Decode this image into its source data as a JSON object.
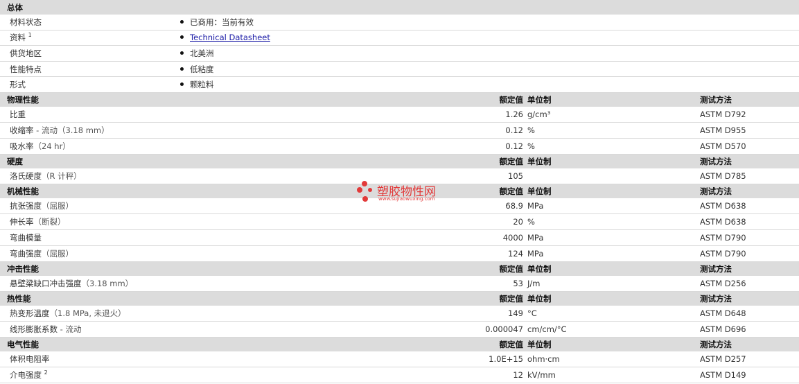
{
  "general": {
    "title": "总体",
    "rows": [
      {
        "label": "材料状态",
        "value": "已商用：当前有效"
      },
      {
        "label": "资料",
        "sup": "1",
        "value": "Technical Datasheet",
        "link": true
      },
      {
        "label": "供货地区",
        "value": "北美洲"
      },
      {
        "label": "性能特点",
        "value": "低粘度"
      },
      {
        "label": "形式",
        "value": "颗粒料"
      }
    ]
  },
  "col_headers": {
    "value": "额定值",
    "unit": "单位制",
    "test": "测试方法"
  },
  "sections": [
    {
      "title": "物理性能",
      "rows": [
        {
          "label": "比重",
          "sub": "",
          "value": "1.26",
          "unit": "g/cm³",
          "test": "ASTM D792"
        },
        {
          "label": "收缩率",
          "sub": " - 流动（3.18 mm）",
          "value": "0.12",
          "unit": "%",
          "test": "ASTM D955"
        },
        {
          "label": "吸水率",
          "sub": "（24 hr）",
          "value": "0.12",
          "unit": "%",
          "test": "ASTM D570"
        }
      ]
    },
    {
      "title": "硬度",
      "rows": [
        {
          "label": "洛氏硬度",
          "sub": "（R 计秤）",
          "value": "105",
          "unit": "",
          "test": "ASTM D785"
        }
      ]
    },
    {
      "title": "机械性能",
      "rows": [
        {
          "label": "抗张强度",
          "sub": "（屈服）",
          "value": "68.9",
          "unit": "MPa",
          "test": "ASTM D638"
        },
        {
          "label": "伸长率",
          "sub": "（断裂）",
          "value": "20",
          "unit": "%",
          "test": "ASTM D638"
        },
        {
          "label": "弯曲模量",
          "sub": "",
          "value": "4000",
          "unit": "MPa",
          "test": "ASTM D790"
        },
        {
          "label": "弯曲强度",
          "sub": "（屈服）",
          "value": "124",
          "unit": "MPa",
          "test": "ASTM D790"
        }
      ]
    },
    {
      "title": "冲击性能",
      "rows": [
        {
          "label": "悬壁梁缺口冲击强度",
          "sub": "（3.18 mm）",
          "value": "53",
          "unit": "J/m",
          "test": "ASTM D256"
        }
      ]
    },
    {
      "title": "热性能",
      "rows": [
        {
          "label": "热变形温度",
          "sub": "（1.8 MPa, 未退火）",
          "value": "149",
          "unit": "°C",
          "test": "ASTM D648"
        },
        {
          "label": "线形膨胀系数",
          "sub": " - 流动",
          "value": "0.000047",
          "unit": "cm/cm/°C",
          "test": "ASTM D696"
        }
      ]
    },
    {
      "title": "电气性能",
      "rows": [
        {
          "label": "体积电阻率",
          "sub": "",
          "value": "1.0E+15",
          "unit": "ohm·cm",
          "test": "ASTM D257"
        },
        {
          "label": "介电强度",
          "sup": "2",
          "sub": "",
          "value": "12",
          "unit": "kV/mm",
          "test": "ASTM D149"
        }
      ]
    }
  ],
  "watermark": {
    "text": "塑胶物性网",
    "url": "www.sujiaowuxing.com",
    "color": "#e23a3a"
  }
}
